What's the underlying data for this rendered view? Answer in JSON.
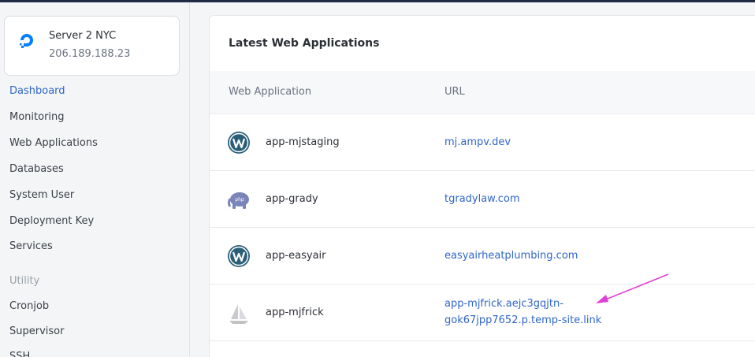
{
  "server": {
    "name": "Server 2 NYC",
    "ip": "206.189.188.23"
  },
  "sidebar": {
    "items": [
      {
        "label": "Dashboard",
        "active": true
      },
      {
        "label": "Monitoring"
      },
      {
        "label": "Web Applications"
      },
      {
        "label": "Databases"
      },
      {
        "label": "System User"
      },
      {
        "label": "Deployment Key"
      },
      {
        "label": "Services"
      }
    ],
    "utility_heading": "Utility",
    "utility_items": [
      {
        "label": "Cronjob"
      },
      {
        "label": "Supervisor"
      },
      {
        "label": "SSH"
      }
    ]
  },
  "panel": {
    "title": "Latest Web Applications",
    "columns": [
      "Web Application",
      "URL"
    ],
    "rows": [
      {
        "name": "app-mjstaging",
        "url": "mj.ampv.dev",
        "url_line2": "",
        "icon": "wordpress-icon"
      },
      {
        "name": "app-grady",
        "url": "tgradylaw.com",
        "url_line2": "",
        "icon": "php-icon"
      },
      {
        "name": "app-easyair",
        "url": "easyairheatplumbing.com",
        "url_line2": "",
        "icon": "wordpress-icon"
      },
      {
        "name": "app-mjfrick",
        "url": "app-mjfrick.aejc3gqjtn-",
        "url_line2": "gok67jpp7652.p.temp-site.link",
        "icon": "sail-icon"
      }
    ]
  },
  "colors": {
    "accent": "#2f66c7",
    "arrow": "#e040d8",
    "wordpress": "#2b5f78",
    "php": "#7a86b8"
  }
}
